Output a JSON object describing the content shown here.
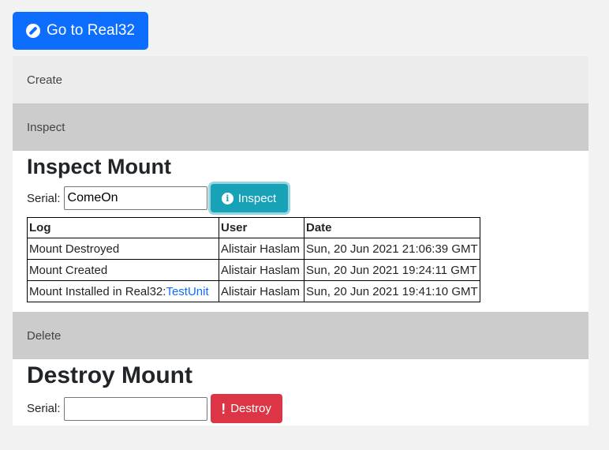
{
  "top_button": {
    "label": "Go to Real32",
    "icon": "compass-icon"
  },
  "sections": {
    "create": {
      "header": "Create"
    },
    "inspect": {
      "header": "Inspect",
      "title": "Inspect Mount",
      "serial_label": "Serial:",
      "serial_value": "ComeOn",
      "button_label": "Inspect",
      "button_icon": "info-icon",
      "table": {
        "headers": [
          "Log",
          "User",
          "Date"
        ],
        "rows": [
          {
            "log": "Mount Destroyed",
            "user": "Alistair Haslam",
            "date": "Sun, 20 Jun 2021 21:06:39 GMT"
          },
          {
            "log": "Mount Created",
            "user": "Alistair Haslam",
            "date": "Sun, 20 Jun 2021 19:24:11 GMT"
          },
          {
            "log": "Mount Installed in Real32:",
            "link": "TestUnit",
            "user": "Alistair Haslam",
            "date": "Sun, 20 Jun 2021 19:41:10 GMT"
          }
        ]
      }
    },
    "delete": {
      "header": "Delete",
      "title": "Destroy Mount",
      "serial_label": "Serial:",
      "serial_value": "",
      "button_label": "Destroy",
      "button_icon": "exclamation-icon"
    }
  },
  "colors": {
    "primary": "#0d6efd",
    "info": "#17a2b8",
    "danger": "#dc3545",
    "link": "#0d6efd"
  }
}
